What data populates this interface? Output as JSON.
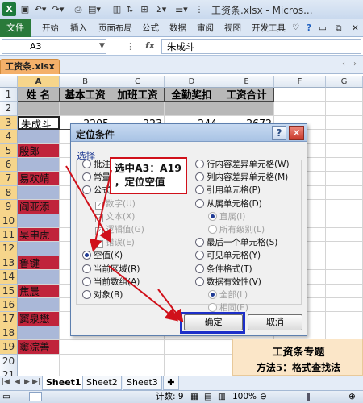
{
  "window": {
    "title": "工资条.xlsx - Micros...",
    "app_icon": "excel-icon",
    "qat": [
      "save-icon",
      "undo-icon",
      "redo-icon",
      "print-preview-icon",
      "format-icon",
      "image-icon",
      "sort-icon",
      "border-icon",
      "sum-icon",
      "filter-icon",
      "more-icon"
    ]
  },
  "ribbon": {
    "file": "文件",
    "tabs": [
      "开始",
      "插入",
      "页面布局",
      "公式",
      "数据",
      "审阅",
      "视图",
      "开发工具"
    ]
  },
  "formula_bar": {
    "name_box": "A3",
    "fx": "fx",
    "content": "朱成斗"
  },
  "workbook_tab": "工资条.xlsx",
  "columns": [
    "A",
    "B",
    "C",
    "D",
    "E",
    "F",
    "G"
  ],
  "rows": [
    {
      "n": "1",
      "cells": [
        "姓 名",
        "基本工资",
        "加班工资",
        "全勤奖扣",
        "工资合计"
      ]
    },
    {
      "n": "2",
      "cells": [
        "",
        "",
        "",
        "",
        ""
      ]
    },
    {
      "n": "3",
      "cells": [
        "朱成斗",
        "2205",
        "223",
        "244",
        "2672"
      ]
    },
    {
      "n": "4",
      "cells": [
        "",
        "",
        "",
        "",
        ""
      ]
    },
    {
      "n": "5",
      "cells": [
        "殷郎",
        "",
        "",
        "",
        ""
      ]
    },
    {
      "n": "6",
      "cells": [
        "",
        "",
        "",
        "",
        ""
      ]
    },
    {
      "n": "7",
      "cells": [
        "易欢靖",
        "",
        "",
        "",
        ""
      ]
    },
    {
      "n": "8",
      "cells": [
        "",
        "",
        "",
        "",
        ""
      ]
    },
    {
      "n": "9",
      "cells": [
        "阎亚添",
        "",
        "",
        "",
        ""
      ]
    },
    {
      "n": "10",
      "cells": [
        "",
        "",
        "",
        "",
        ""
      ]
    },
    {
      "n": "11",
      "cells": [
        "吴申虎",
        "",
        "",
        "",
        ""
      ]
    },
    {
      "n": "12",
      "cells": [
        "",
        "",
        "",
        "",
        ""
      ]
    },
    {
      "n": "13",
      "cells": [
        "鲁键",
        "",
        "",
        "",
        ""
      ]
    },
    {
      "n": "14",
      "cells": [
        "",
        "",
        "",
        "",
        ""
      ]
    },
    {
      "n": "15",
      "cells": [
        "焦晨",
        "",
        "",
        "",
        ""
      ]
    },
    {
      "n": "16",
      "cells": [
        "",
        "",
        "",
        "",
        ""
      ]
    },
    {
      "n": "17",
      "cells": [
        "窦泉懋",
        "",
        "",
        "",
        ""
      ]
    },
    {
      "n": "18",
      "cells": [
        "",
        "",
        "",
        "",
        ""
      ]
    },
    {
      "n": "19",
      "cells": [
        "窦淙善",
        "",
        "",
        "",
        ""
      ]
    },
    {
      "n": "20",
      "cells": [
        "",
        "",
        "",
        "",
        ""
      ]
    },
    {
      "n": "21",
      "cells": [
        "",
        "",
        "",
        "",
        ""
      ]
    },
    {
      "n": "22",
      "cells": [
        "",
        "",
        "",
        "",
        ""
      ]
    }
  ],
  "dialog": {
    "title": "定位条件",
    "help": "?",
    "close": "✕",
    "group_label": "选择",
    "left_options": [
      {
        "label": "批注(C)",
        "kind": "radio",
        "selected": false,
        "disabled": false
      },
      {
        "label": "常量(O)",
        "kind": "radio",
        "selected": false,
        "disabled": false
      },
      {
        "label": "公式(F)",
        "kind": "radio",
        "selected": false,
        "disabled": false
      },
      {
        "label": "数字(U)",
        "kind": "check",
        "selected": true,
        "disabled": true
      },
      {
        "label": "文本(X)",
        "kind": "check",
        "selected": true,
        "disabled": true
      },
      {
        "label": "逻辑值(G)",
        "kind": "check",
        "selected": true,
        "disabled": true
      },
      {
        "label": "错误(E)",
        "kind": "check",
        "selected": true,
        "disabled": true
      },
      {
        "label": "空值(K)",
        "kind": "radio",
        "selected": true,
        "disabled": false
      },
      {
        "label": "当前区域(R)",
        "kind": "radio",
        "selected": false,
        "disabled": false
      },
      {
        "label": "当前数组(A)",
        "kind": "radio",
        "selected": false,
        "disabled": false
      },
      {
        "label": "对象(B)",
        "kind": "radio",
        "selected": false,
        "disabled": false
      }
    ],
    "right_options": [
      {
        "label": "行内容差异单元格(W)",
        "kind": "radio",
        "selected": false,
        "disabled": false
      },
      {
        "label": "列内容差异单元格(M)",
        "kind": "radio",
        "selected": false,
        "disabled": false
      },
      {
        "label": "引用单元格(P)",
        "kind": "radio",
        "selected": false,
        "disabled": false
      },
      {
        "label": "从属单元格(D)",
        "kind": "radio",
        "selected": false,
        "disabled": false
      },
      {
        "label": "直属(I)",
        "kind": "radio",
        "selected": true,
        "disabled": true
      },
      {
        "label": "所有级别(L)",
        "kind": "radio",
        "selected": false,
        "disabled": true
      },
      {
        "label": "最后一个单元格(S)",
        "kind": "radio",
        "selected": false,
        "disabled": false
      },
      {
        "label": "可见单元格(Y)",
        "kind": "radio",
        "selected": false,
        "disabled": false
      },
      {
        "label": "条件格式(T)",
        "kind": "radio",
        "selected": false,
        "disabled": false
      },
      {
        "label": "数据有效性(V)",
        "kind": "radio",
        "selected": false,
        "disabled": false
      },
      {
        "label": "全部(L)",
        "kind": "radio",
        "selected": true,
        "disabled": true
      },
      {
        "label": "相同(E)",
        "kind": "radio",
        "selected": false,
        "disabled": true
      }
    ],
    "ok": "确定",
    "cancel": "取消"
  },
  "callout": {
    "line1": "选中A3：A19",
    "line2": "，定位空值"
  },
  "banner": {
    "title": "工资条专题",
    "subtitle": "方法5：格式查找法"
  },
  "sheets": [
    "Sheet1",
    "Sheet2",
    "Sheet3"
  ],
  "status": {
    "count_label": "计数: 9",
    "zoom": "100%"
  },
  "colors": {
    "highlight_red": "#c0243b",
    "highlight_blue": "#aab8d8",
    "header_gray": "#b8b8b8",
    "annotation_red": "#d0101a",
    "annotation_blue": "#1d2fc8"
  }
}
